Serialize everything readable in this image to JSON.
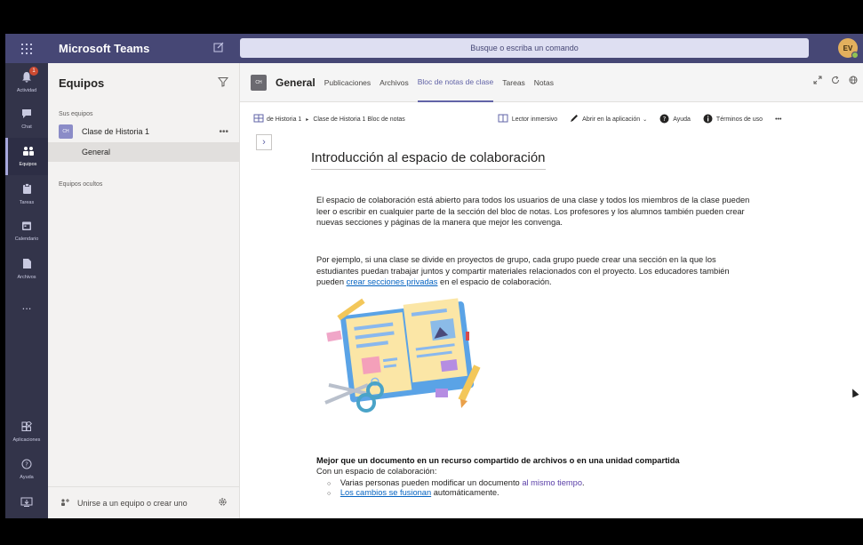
{
  "app": {
    "title": "Microsoft Teams",
    "search_placeholder": "Busque o escriba un comando",
    "avatar_initials": "EV"
  },
  "rail": {
    "items": [
      {
        "label": "Actividad",
        "icon": "bell-icon",
        "badge": "1"
      },
      {
        "label": "Chat",
        "icon": "chat-icon"
      },
      {
        "label": "Equipos",
        "icon": "teams-icon"
      },
      {
        "label": "Tareas",
        "icon": "tasks-icon"
      },
      {
        "label": "Calendario",
        "icon": "calendar-icon"
      },
      {
        "label": "Archivos",
        "icon": "files-icon"
      },
      {
        "label": "...",
        "icon": "more-icon"
      }
    ],
    "bottom": [
      {
        "label": "Aplicaciones",
        "icon": "apps-icon"
      },
      {
        "label": "Ayuda",
        "icon": "help-icon"
      }
    ]
  },
  "panel": {
    "title": "Equipos",
    "section_label": "Sus equipos",
    "team": {
      "initials": "CH",
      "name": "Clase de Historia 1"
    },
    "channel": "General",
    "hidden_label": "Equipos ocultos",
    "footer": "Unirse a un equipo o crear uno"
  },
  "channel_header": {
    "initials": "CH",
    "title": "General",
    "tabs": [
      "Publicaciones",
      "Archivos",
      "Bloc de notas de clase",
      "Tareas",
      "Notas"
    ]
  },
  "onenote_bar": {
    "crumb_left": "de Historia 1",
    "crumb_right": "Clase de Historia 1 Bloc de notas",
    "tools": [
      "Lector inmersivo",
      "Abrir en la aplicación",
      "Ayuda",
      "Términos de uso",
      "•••"
    ]
  },
  "page": {
    "title": "Introducción al espacio de colaboración",
    "para1": "El espacio de colaboración está abierto para todos los usuarios de una clase y todos los miembros de la clase pueden leer o escribir en cualquier parte de la sección del bloc de notas. Los profesores y los alumnos también pueden crear nuevas secciones y páginas de la manera que mejor les convenga.",
    "para2_pre": "Por ejemplo, si una clase se divide en proyectos de grupo, cada grupo puede crear una sección en la que los estudiantes puedan trabajar juntos y compartir materiales relacionados con el proyecto. Los educadores también pueden ",
    "para2_link": "crear secciones privadas",
    "para2_post": " en el espacio de colaboración.",
    "subtitle": "Mejor que un documento en un recurso compartido de archivos o en una unidad compartida",
    "subline": "Con un espacio de colaboración:",
    "bullet1_pre": "Varias personas pueden modificar un documento ",
    "bullet1_hl": "al mismo tiempo",
    "bullet1_post": ".",
    "bullet2_hl": "Los cambios se fusionan",
    "bullet2_post": " automáticamente."
  }
}
